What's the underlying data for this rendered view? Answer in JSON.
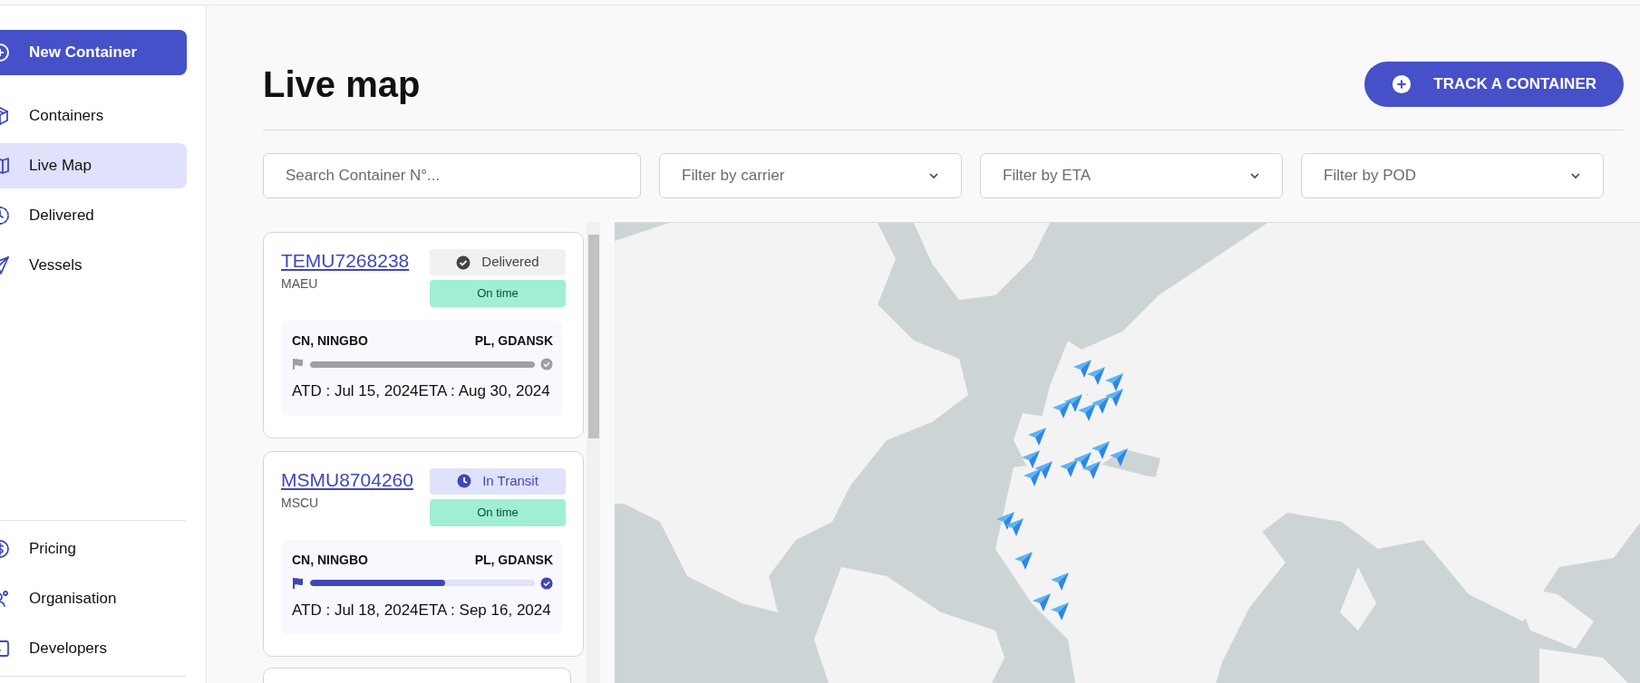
{
  "sidebar": {
    "new_button": {
      "label": "New Container"
    },
    "items": [
      {
        "label": "Containers",
        "selected": false
      },
      {
        "label": "Live Map",
        "selected": true
      },
      {
        "label": "Delivered",
        "selected": false
      },
      {
        "label": "Vessels",
        "selected": false
      }
    ],
    "footer_items": [
      {
        "label": "Pricing"
      },
      {
        "label": "Organisation"
      },
      {
        "label": "Developers"
      }
    ]
  },
  "header": {
    "title": "Live map",
    "action": "TRACK A CONTAINER"
  },
  "filters": {
    "search": {
      "placeholder": "Search Container N°..."
    },
    "dropdowns": [
      {
        "placeholder": "Filter by carrier"
      },
      {
        "placeholder": "Filter by ETA"
      },
      {
        "placeholder": "Filter by POD"
      }
    ]
  },
  "containers": [
    {
      "number": "TEMU7268238",
      "carrier": "MAEU",
      "status": {
        "kind": "delivered",
        "label": "Delivered"
      },
      "timeliness": "On time",
      "origin": "CN, NINGBO",
      "destination": "PL, GDANSK",
      "level": 1,
      "dates": "ATD : Jul 15, 2024ETA : Aug 30, 2024"
    },
    {
      "number": "MSMU8704260",
      "carrier": "MSCU",
      "status": {
        "kind": "in_transit",
        "label": "In Transit"
      },
      "timeliness": "On time",
      "origin": "CN, NINGBO",
      "destination": "PL, GDANSK",
      "level": 0.6,
      "dates": "ATD : Jul 18, 2024ETA : Sep 16, 2024"
    }
  ]
}
